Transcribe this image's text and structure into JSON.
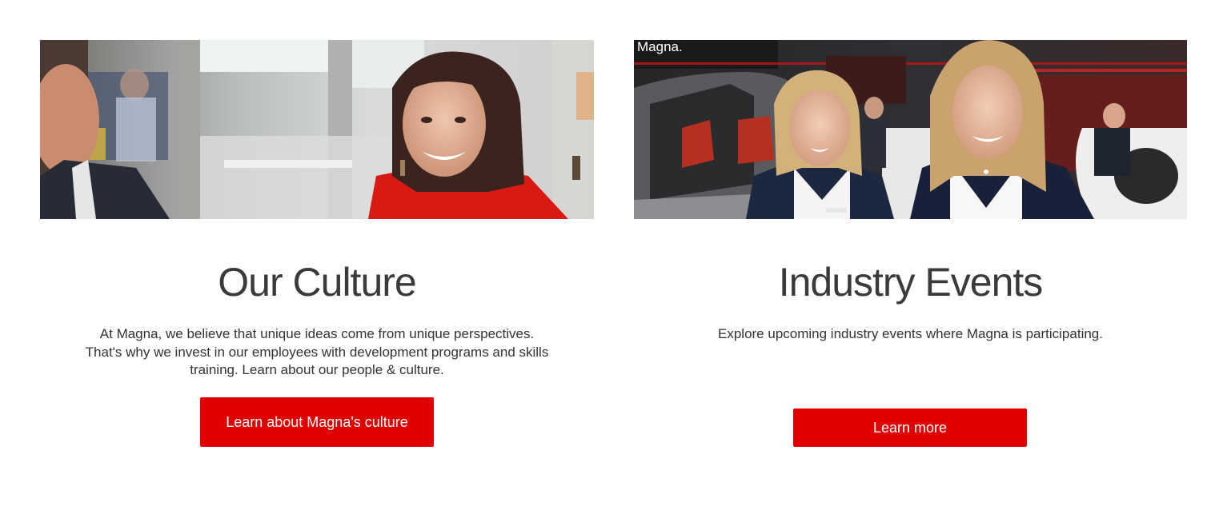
{
  "cards": [
    {
      "title": "Our Culture",
      "description": "At Magna, we believe that unique ideas come from unique perspectives. That's why we invest in our employees with development programs and skills training. Learn about our people & culture.",
      "button_label": "Learn about Magna's culture",
      "image_alt": "Smiling employee in red shirt in office"
    },
    {
      "title": "Industry Events",
      "description": "Explore upcoming industry events where Magna is participating.",
      "button_label": "Learn more",
      "image_alt": "Two Magna representatives at an industry event booth"
    }
  ],
  "hero_signage": {
    "brand_text": "Magna."
  },
  "colors": {
    "accent": "#e00000",
    "text": "#333333",
    "title": "#3a3a3a"
  }
}
